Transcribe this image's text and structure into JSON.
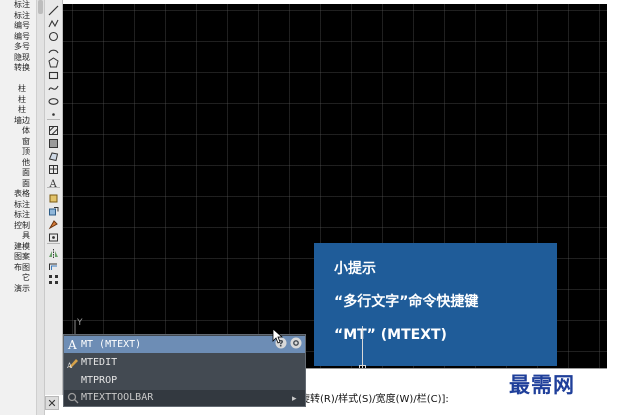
{
  "palette": {
    "items": [
      "标注",
      "标注",
      "编号",
      "编号",
      "多号",
      "隐现",
      "转换",
      "",
      "柱",
      "柱",
      "柱",
      "墙边",
      "体",
      "窗",
      "顶",
      "他",
      "面",
      "面",
      "表格",
      "标注",
      "标注",
      "控制",
      "具",
      "建模",
      "图案",
      "布图",
      "它",
      "演示"
    ]
  },
  "toolbar": {
    "icons": [
      "line-icon",
      "polyline-icon",
      "circle-icon",
      "arc-icon",
      "polygon-icon",
      "rectangle-icon",
      "spline-icon",
      "ellipse-icon",
      "point-icon",
      "hatch-icon",
      "gradient-icon",
      "region-icon",
      "table-icon",
      "text-icon",
      "insert-block-icon",
      "make-block-icon",
      "paint-icon",
      "attribute-icon",
      "mirror-icon",
      "offset-icon",
      "array-icon"
    ]
  },
  "canvas": {
    "ucs_label": "Y",
    "tip": {
      "title": "小提示",
      "line1": "“多行文字”命令快捷键",
      "line2": "“MT” (MTEXT)"
    }
  },
  "autocomplete": {
    "items": [
      {
        "label": "MT (MTEXT)",
        "selected": true
      },
      {
        "label": "MTEDIT",
        "selected": false
      },
      {
        "label": "MTPROP",
        "selected": false
      }
    ],
    "footer": "MTEXTTOOLBAR"
  },
  "command_line": {
    "prompt": "旋转(R)/样式(S)/宽度(W)/栏(C)]:"
  },
  "watermark": "最需网",
  "colors": {
    "canvas_bg": "#000000",
    "tip_bg": "#1f5c99",
    "popup_bg": "#434a52",
    "popup_selected": "#6d8db5",
    "watermark": "#1f3f9a"
  }
}
